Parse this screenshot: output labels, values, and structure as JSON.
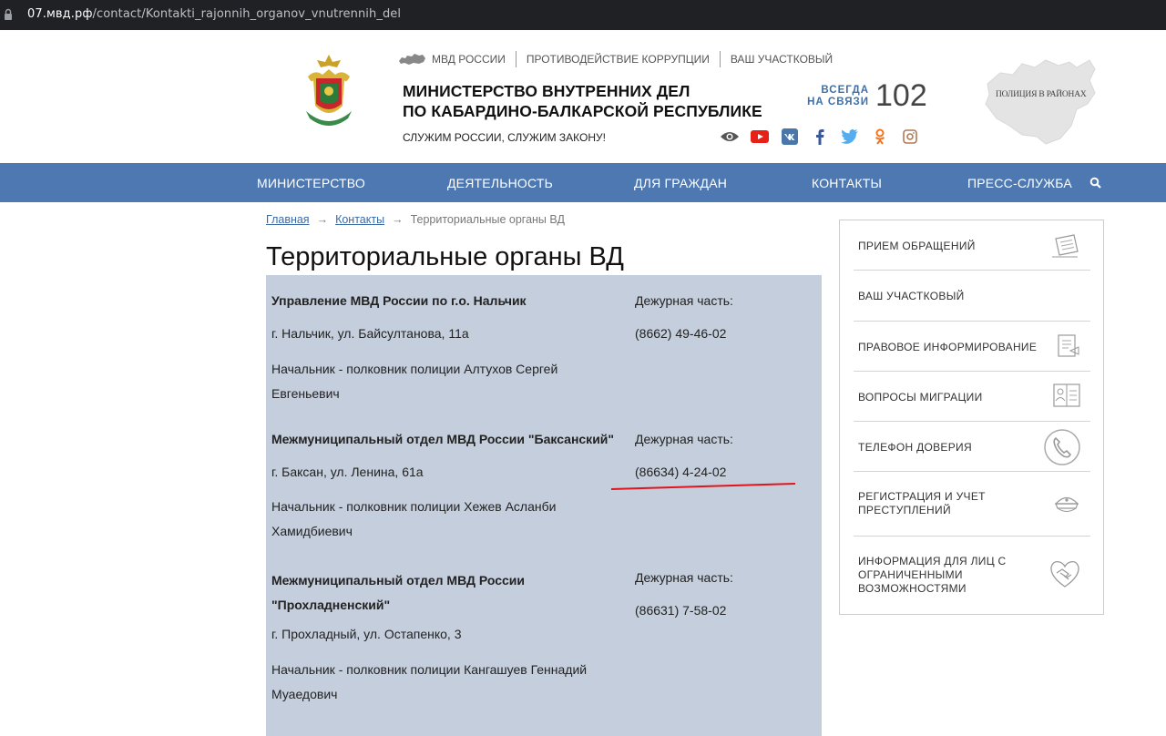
{
  "browser": {
    "url_domain": "07.мвд.рф",
    "url_path": "/contact/Kontakti_rajonnih_organov_vnutrennih_del"
  },
  "header": {
    "top_links": [
      "МВД РОССИИ",
      "ПРОТИВОДЕЙСТВИЕ КОРРУПЦИИ",
      "ВАШ УЧАСТКОВЫЙ"
    ],
    "title_line1": "МИНИСТЕРСТВО ВНУТРЕННИХ ДЕЛ",
    "title_line2": "ПО КАБАРДИНО-БАЛКАРСКОЙ РЕСПУБЛИКЕ",
    "motto": "СЛУЖИМ РОССИИ, СЛУЖИМ ЗАКОНУ!",
    "always_line1": "ВСЕГДА",
    "always_line2": "НА СВЯЗИ",
    "phone": "102",
    "map_badge": "ПОЛИЦИЯ В РАЙОНАХ",
    "socials": [
      "eye-icon",
      "youtube-icon",
      "vk-icon",
      "facebook-icon",
      "twitter-icon",
      "odnoklassniki-icon",
      "instagram-icon"
    ],
    "accent": "#4e78b1"
  },
  "nav": {
    "items": [
      "МИНИСТЕРСТВО",
      "ДЕЯТЕЛЬНОСТЬ",
      "ДЛЯ ГРАЖДАН",
      "КОНТАКТЫ",
      "ПРЕСС-СЛУЖБА"
    ]
  },
  "breadcrumb": {
    "home": "Главная",
    "contacts": "Контакты",
    "current": "Территориальные органы ВД"
  },
  "page_title": "Территориальные органы ВД",
  "departments": [
    {
      "name": "Управление МВД России по г.о. Нальчик",
      "address": "г. Нальчик, ул. Байсултанова, 11а",
      "head_line1": "Начальник - полковник полиции Алтухов Сергей",
      "head_line2": "Евгеньевич",
      "duty_label": "Дежурная часть:",
      "duty_phone": "(8662) 49-46-02"
    },
    {
      "name": "Межмуниципальный отдел МВД России \"Баксанский\"",
      "address": "г. Баксан, ул. Ленина,  61а",
      "head_line1": "Начальник - полковник полиции Хежев Асланби",
      "head_line2": "Хамидбиевич",
      "duty_label": "Дежурная часть:",
      "duty_phone": "(86634) 4-24-02"
    },
    {
      "name_line1": "Межмуниципальный отдел МВД России",
      "name_line2": "\"Прохладненский\"",
      "address": "г. Прохладный, ул. Остапенко, 3",
      "head_line1": "Начальник - полковник полиции Кангашуев Геннадий",
      "head_line2": "Муаедович",
      "duty_label": "Дежурная часть:",
      "duty_phone": "(86631) 7-58-02"
    }
  ],
  "sidebar": {
    "items": [
      {
        "label": "ПРИЕМ ОБРАЩЕНИЙ",
        "icon": "document-pen-icon"
      },
      {
        "label": "ВАШ УЧАСТКОВЫЙ",
        "icon": ""
      },
      {
        "label": "ПРАВОВОЕ ИНФОРМИРОВАНИЕ",
        "icon": "legal-document-icon"
      },
      {
        "label": "ВОПРОСЫ МИГРАЦИИ",
        "icon": "passport-icon"
      },
      {
        "label": "ТЕЛЕФОН ДОВЕРИЯ",
        "icon": "phone-icon"
      },
      {
        "label_line1": "РЕГИСТРАЦИЯ И УЧЕТ",
        "label_line2": "ПРЕСТУПЛЕНИЙ",
        "icon": "police-cap-icon"
      },
      {
        "label_line1": "ИНФОРМАЦИЯ ДЛЯ ЛИЦ С",
        "label_line2": "ОГРАНИЧЕННЫМИ",
        "label_line3": "ВОЗМОЖНОСТЯМИ",
        "icon": "handshake-heart-icon"
      }
    ]
  }
}
